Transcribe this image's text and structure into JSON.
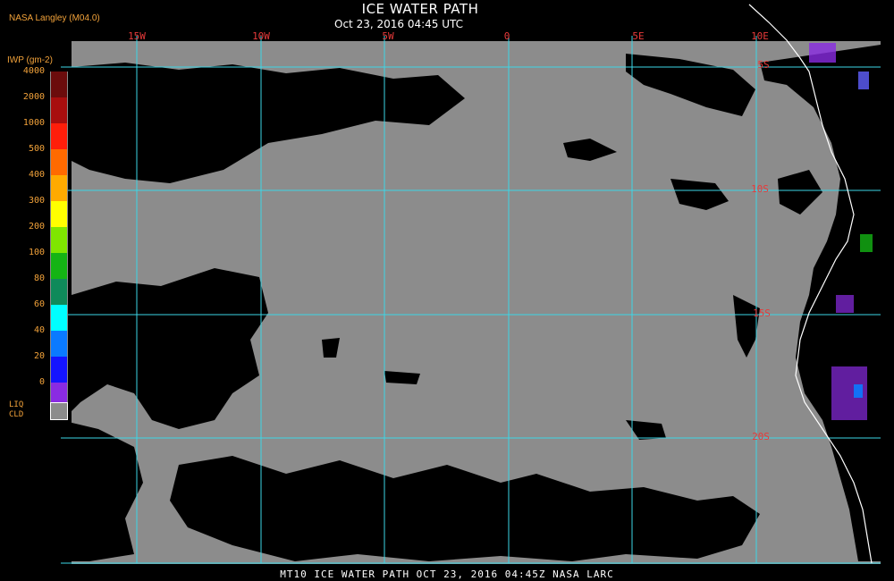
{
  "header": {
    "agency": "NASA Langley (M04.0)",
    "title": "ICE WATER PATH",
    "subtitle": "Oct 23, 2016 04:45 UTC"
  },
  "legend": {
    "units_label": "IWP (gm-2)",
    "levels": [
      {
        "label": "4000",
        "color": "#6b0c0c"
      },
      {
        "label": "2000",
        "color": "#a80e0e"
      },
      {
        "label": "1000",
        "color": "#ff1e0a"
      },
      {
        "label": "500",
        "color": "#ff6a00"
      },
      {
        "label": "400",
        "color": "#ffaa00"
      },
      {
        "label": "300",
        "color": "#ffff00"
      },
      {
        "label": "200",
        "color": "#7fe600"
      },
      {
        "label": "100",
        "color": "#14b414"
      },
      {
        "label": "80",
        "color": "#0f8a5a"
      },
      {
        "label": "60",
        "color": "#00ffff"
      },
      {
        "label": "40",
        "color": "#0a7aff"
      },
      {
        "label": "20",
        "color": "#1414ff"
      },
      {
        "label": "0",
        "color": "#8a2be2"
      }
    ],
    "liq_label_line1": "LIQ",
    "liq_label_line2": "CLD",
    "liq_color": "#8c8c8c"
  },
  "map": {
    "longitude_labels": [
      "15W",
      "10W",
      "5W",
      "0",
      "5E",
      "10E"
    ],
    "latitude_labels": [
      "5S",
      "10S",
      "15S",
      "20S"
    ],
    "grid_color": "#3cd6e6",
    "lat_label_color": "#e83a3a",
    "cloud_color": "#8c8c8c",
    "clear_color": "#000000",
    "coast_color": "#ffffff"
  },
  "footer": {
    "caption": "MT10  ICE WATER PATH  OCT 23, 2016 04:45Z  NASA LARC"
  }
}
